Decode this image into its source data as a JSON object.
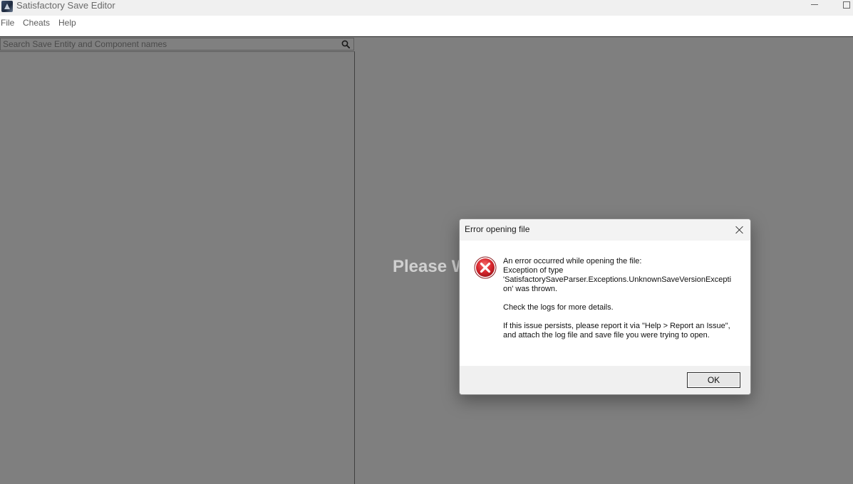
{
  "window": {
    "title": "Satisfactory Save Editor",
    "icon": "app-icon"
  },
  "menu": {
    "items": [
      "File",
      "Cheats",
      "Help"
    ]
  },
  "search": {
    "placeholder": "Search Save Entity and Component names",
    "icon": "search-icon"
  },
  "main": {
    "loading_text": "Please W"
  },
  "dialog": {
    "title": "Error opening file",
    "icon": "error-icon",
    "message": {
      "line1": "An error occurred while opening the file:",
      "line2": "Exception of type",
      "line3": "'SatisfactorySaveParser.Exceptions.UnknownSaveVersionException' was thrown.",
      "line4": "Check the logs for more details.",
      "line5": "If this issue persists, please report it via \"Help > Report an Issue\", and attach the log file and save file you were trying to open."
    },
    "ok_label": "OK"
  },
  "colors": {
    "background": "#7f7f7f",
    "error_red": "#d9272e"
  }
}
